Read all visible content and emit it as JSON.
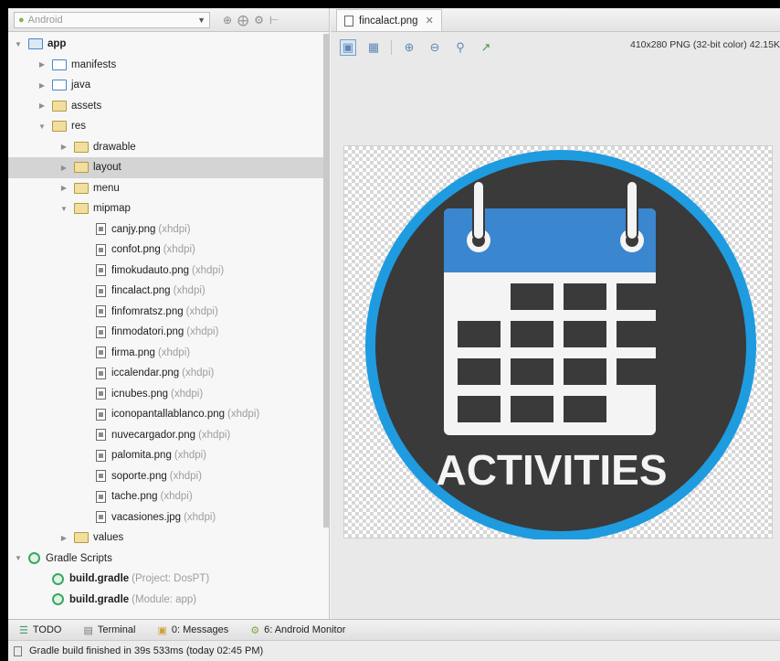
{
  "project_panel": {
    "view_selector": "Android",
    "tree": [
      {
        "level": 0,
        "arrow": "open",
        "icon": "module",
        "label": "app",
        "bold": true,
        "hint": ""
      },
      {
        "level": 1,
        "arrow": "closed",
        "icon": "folder",
        "label": "manifests",
        "hint": ""
      },
      {
        "level": 1,
        "arrow": "closed",
        "icon": "folder",
        "label": "java",
        "hint": ""
      },
      {
        "level": 1,
        "arrow": "closed",
        "icon": "yellow",
        "label": "assets",
        "hint": ""
      },
      {
        "level": 1,
        "arrow": "open",
        "icon": "yellow",
        "label": "res",
        "hint": ""
      },
      {
        "level": 2,
        "arrow": "closed",
        "icon": "yellow",
        "label": "drawable",
        "hint": ""
      },
      {
        "level": 2,
        "arrow": "closed",
        "icon": "yellow",
        "label": "layout",
        "hint": "",
        "selected": true
      },
      {
        "level": 2,
        "arrow": "closed",
        "icon": "yellow",
        "label": "menu",
        "hint": ""
      },
      {
        "level": 2,
        "arrow": "open",
        "icon": "yellow",
        "label": "mipmap",
        "hint": ""
      },
      {
        "level": 3,
        "arrow": "none",
        "icon": "image",
        "label": "canjy.png",
        "hint": "(xhdpi)"
      },
      {
        "level": 3,
        "arrow": "none",
        "icon": "image",
        "label": "confot.png",
        "hint": "(xhdpi)"
      },
      {
        "level": 3,
        "arrow": "none",
        "icon": "image",
        "label": "fimokudauto.png",
        "hint": "(xhdpi)"
      },
      {
        "level": 3,
        "arrow": "none",
        "icon": "image",
        "label": "fincalact.png",
        "hint": "(xhdpi)"
      },
      {
        "level": 3,
        "arrow": "none",
        "icon": "image",
        "label": "finfomratsz.png",
        "hint": "(xhdpi)"
      },
      {
        "level": 3,
        "arrow": "none",
        "icon": "image",
        "label": "finmodatori.png",
        "hint": "(xhdpi)"
      },
      {
        "level": 3,
        "arrow": "none",
        "icon": "image",
        "label": "firma.png",
        "hint": "(xhdpi)"
      },
      {
        "level": 3,
        "arrow": "none",
        "icon": "image",
        "label": "iccalendar.png",
        "hint": "(xhdpi)"
      },
      {
        "level": 3,
        "arrow": "none",
        "icon": "image",
        "label": "icnubes.png",
        "hint": "(xhdpi)"
      },
      {
        "level": 3,
        "arrow": "none",
        "icon": "image",
        "label": "iconopantallablanco.png",
        "hint": "(xhdpi)"
      },
      {
        "level": 3,
        "arrow": "none",
        "icon": "image",
        "label": "nuvecargador.png",
        "hint": "(xhdpi)"
      },
      {
        "level": 3,
        "arrow": "none",
        "icon": "image",
        "label": "palomita.png",
        "hint": "(xhdpi)"
      },
      {
        "level": 3,
        "arrow": "none",
        "icon": "image",
        "label": "soporte.png",
        "hint": "(xhdpi)"
      },
      {
        "level": 3,
        "arrow": "none",
        "icon": "image",
        "label": "tache.png",
        "hint": "(xhdpi)"
      },
      {
        "level": 3,
        "arrow": "none",
        "icon": "image",
        "label": "vacasiones.jpg",
        "hint": "(xhdpi)"
      },
      {
        "level": 2,
        "arrow": "closed",
        "icon": "yellow",
        "label": "values",
        "hint": ""
      },
      {
        "level": 0,
        "arrow": "open",
        "icon": "gradle",
        "label": "Gradle Scripts",
        "hint": ""
      },
      {
        "level": 1,
        "arrow": "none",
        "icon": "gradle",
        "label": "build.gradle",
        "bold": true,
        "hint": "(Project: DosPT)"
      },
      {
        "level": 1,
        "arrow": "none",
        "icon": "gradle",
        "label": "build.gradle",
        "bold": true,
        "hint": "(Module: app)"
      }
    ]
  },
  "editor": {
    "tab_label": "fincalact.png",
    "image_info": "410x280 PNG (32-bit color) 42.15K",
    "image_caption": "ACTIVITIES",
    "colors": {
      "ring": "#1f9be0",
      "disc": "#3a3a3a",
      "header_blue": "#3a86cf",
      "page_white": "#f4f4f4",
      "cell_dark": "#3a3a3a"
    }
  },
  "tool_windows": [
    {
      "icon": "todo-icon",
      "label": "TODO"
    },
    {
      "icon": "terminal-icon",
      "label": "Terminal"
    },
    {
      "icon": "messages-icon",
      "label": "0: Messages"
    },
    {
      "icon": "android-monitor-icon",
      "label": "6: Android Monitor"
    }
  ],
  "status": {
    "message": "Gradle build finished in 39s 533ms (today 02:45 PM)"
  }
}
